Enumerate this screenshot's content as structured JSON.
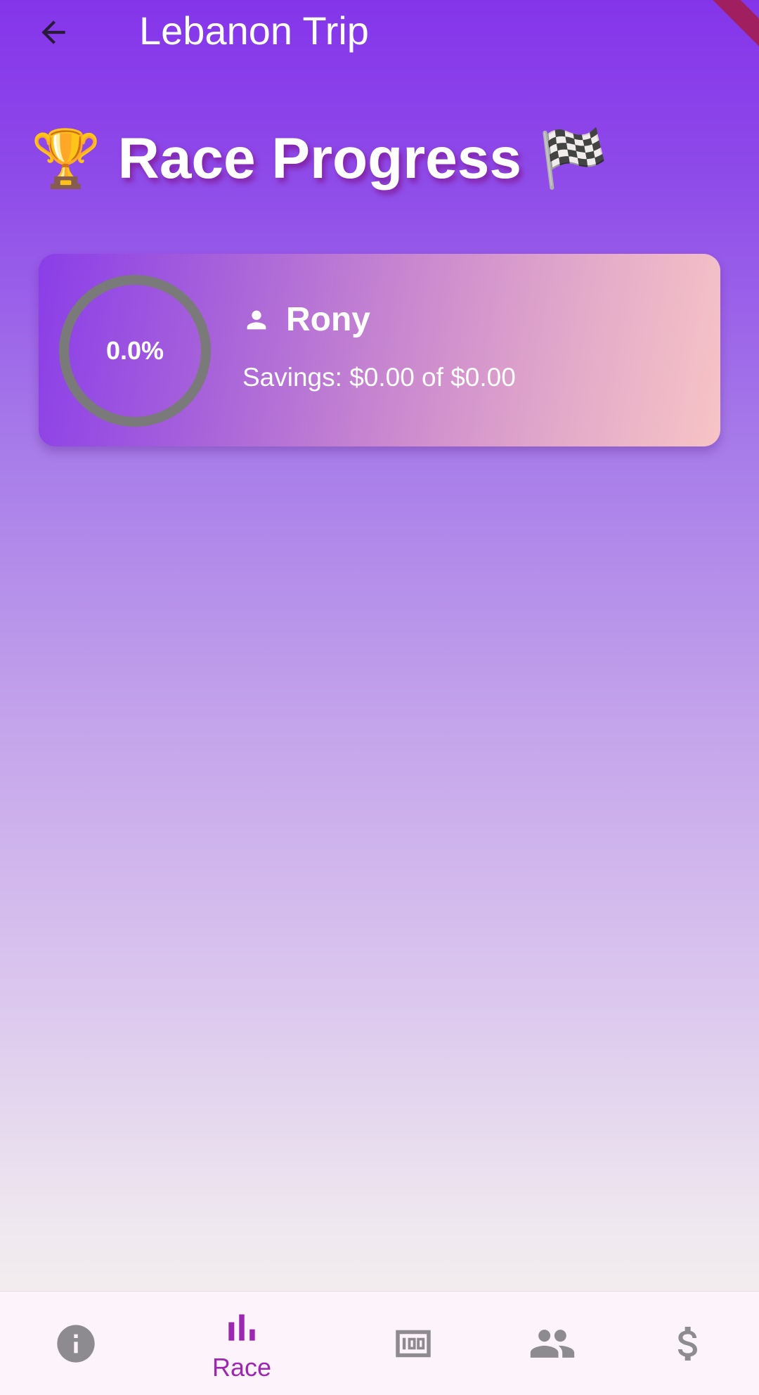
{
  "app_bar": {
    "title": "Lebanon Trip",
    "back_icon": "arrow-back-icon"
  },
  "heading": {
    "leading_emoji": "🏆",
    "title": "Race Progress",
    "trailing_emoji": "🏁"
  },
  "participants": [
    {
      "icon": "person-icon",
      "name": "Rony",
      "progress_text": "0.0%",
      "progress_fraction": 0.0,
      "savings_text": "Savings: $0.00 of $0.00"
    }
  ],
  "bottom_nav": {
    "items": [
      {
        "icon": "info-icon",
        "label": ""
      },
      {
        "icon": "bar-chart-icon",
        "label": "Race",
        "selected": true
      },
      {
        "icon": "counter-100-icon",
        "label": ""
      },
      {
        "icon": "people-icon",
        "label": ""
      },
      {
        "icon": "dollar-icon",
        "label": ""
      }
    ]
  },
  "colors": {
    "accent": "#9C27B0",
    "top_gradient": "#8435EA",
    "bottom_gradient": "#F7F4EE",
    "ring_track": "#7A7A7A",
    "inactive_icon": "#8E8B90"
  }
}
